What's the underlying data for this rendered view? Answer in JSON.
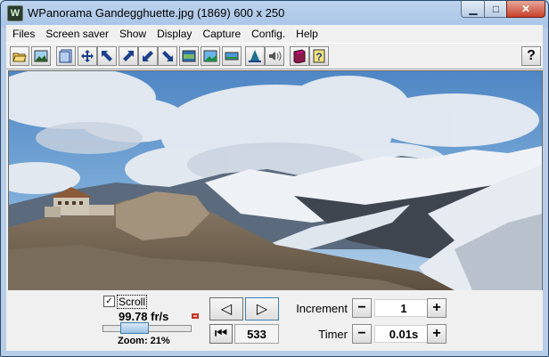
{
  "window": {
    "title": "WPanorama  Gandegghuette.jpg   (1869) 600 x 250",
    "app_icon_letter": "W",
    "min_glyph": "▁",
    "max_glyph": "□",
    "close_glyph": "✕"
  },
  "menu": [
    "Files",
    "Screen saver",
    "Show",
    "Display",
    "Capture",
    "Config.",
    "Help"
  ],
  "toolbar": {
    "buttons": [
      "open-icon",
      "image-icon",
      "panel-icon",
      "move-icon",
      "scroll-nw-icon",
      "scroll-ne-icon",
      "scroll-sw-icon",
      "scroll-se-icon",
      "view-wide-icon",
      "view-sky-icon",
      "view-strip-icon",
      "flip-icon",
      "sound-icon",
      "book-icon",
      "help-doc-icon"
    ],
    "help_label": "?"
  },
  "panel": {
    "scroll_checked": "✓",
    "scroll_label": "Scroll",
    "fps": "99.78 fr/s",
    "zoom": "Zoom: 21%",
    "zoom_level": 0.3,
    "prev_glyph": "◁",
    "next_glyph": "▷",
    "home_glyph": "⏮",
    "position": "533",
    "increment_label": "Increment",
    "increment_value": "1",
    "timer_label": "Timer",
    "timer_value": "0.01s",
    "minus": "−",
    "plus": "+"
  }
}
